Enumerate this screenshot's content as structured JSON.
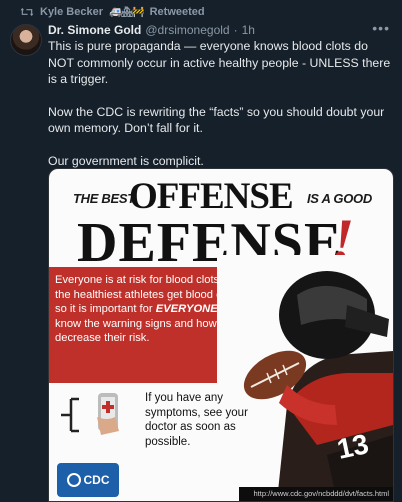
{
  "retweet": {
    "label": "Kyle Becker",
    "emojis": "🚑🏘🚧",
    "action": "Retweeted"
  },
  "tweet": {
    "author_name": "Dr. Simone Gold",
    "handle": "@drsimonegold",
    "separator": "·",
    "time": "1h",
    "paragraphs": [
      "This is pure propaganda — everyone knows blood clots do NOT commonly occur in active healthy people - UNLESS there is a trigger.",
      "Now the CDC is rewriting the “facts” so you should doubt your own memory. Don’t fall for it.",
      "Our government is complicit."
    ]
  },
  "media": {
    "the_best": "THE BEST",
    "offense": "OFFENSE",
    "is_a_good": "IS A GOOD",
    "defense": "DEFENSE",
    "exclaim": "!",
    "red_text_part1": "Everyone is at risk for blood clots! Even the healthiest athletes get blood clots, so it is important for ",
    "red_text_emphasis": "EVERYONE",
    "red_text_part2": " to know the warning signs and how to decrease their risk.",
    "symptom_text": "If you have any symptoms, see your doctor as soon as possible.",
    "jersey_number": "13",
    "cdc_label": "CDC",
    "url": "http://www.cdc.gov/ncbddd/dvt/facts.html"
  },
  "colors": {
    "background": "#15202b",
    "text": "#e7e9ea",
    "muted": "#8b98a5",
    "cdc_red": "#c0302a",
    "cdc_blue": "#1d5fa8"
  }
}
